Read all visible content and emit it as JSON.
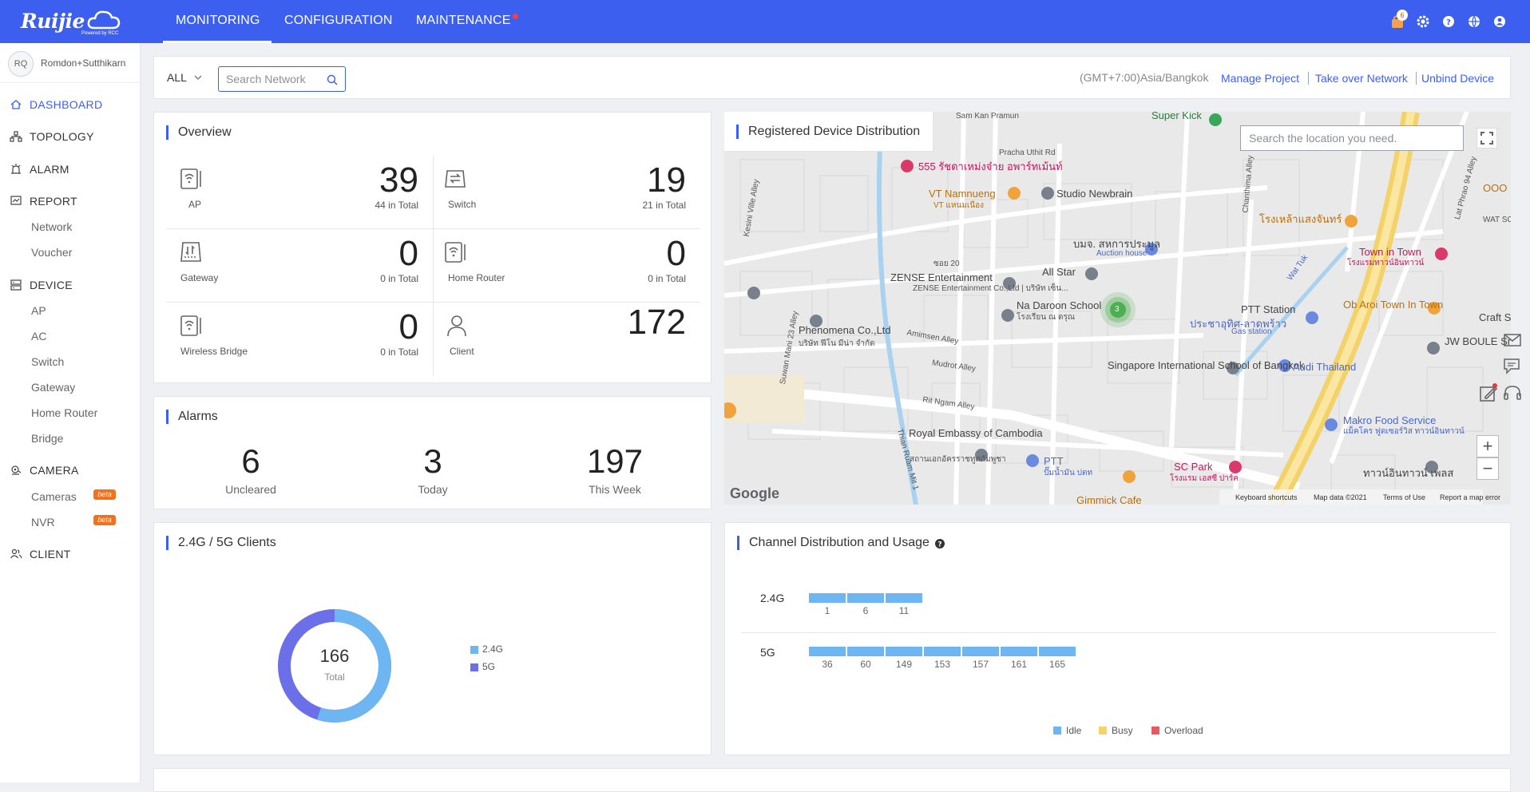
{
  "brand": {
    "name": "Ruijie",
    "sub": "Powered by RCC"
  },
  "nav": {
    "items": [
      {
        "label": "MONITORING"
      },
      {
        "label": "CONFIGURATION"
      },
      {
        "label": "MAINTENANCE"
      }
    ],
    "notification_count": "6"
  },
  "sidebar": {
    "user": {
      "initials": "RQ",
      "name": "Romdon+Sutthikarn"
    },
    "items": [
      {
        "label": "DASHBOARD"
      },
      {
        "label": "TOPOLOGY"
      },
      {
        "label": "ALARM"
      },
      {
        "label": "REPORT"
      },
      {
        "label": "DEVICE"
      },
      {
        "label": "CAMERA"
      },
      {
        "label": "CLIENT"
      }
    ],
    "report_sub": [
      "Network",
      "Voucher"
    ],
    "device_sub": [
      "AP",
      "AC",
      "Switch",
      "Gateway",
      "Home Router",
      "Bridge"
    ],
    "camera_sub": [
      "Cameras",
      "NVR"
    ],
    "beta_label": "beta"
  },
  "filter": {
    "scope": "ALL",
    "search_placeholder": "Search Network",
    "timezone": "(GMT+7:00)Asia/Bangkok",
    "links": [
      "Manage Project",
      "Take over Network",
      "Unbind Device"
    ]
  },
  "overview": {
    "title": "Overview",
    "cells": [
      {
        "name": "AP",
        "count": "39",
        "total": "44 in Total"
      },
      {
        "name": "Switch",
        "count": "19",
        "total": "21 in Total"
      },
      {
        "name": "Gateway",
        "count": "0",
        "total": "0 in Total"
      },
      {
        "name": "Home Router",
        "count": "0",
        "total": "0 in Total"
      },
      {
        "name": "Wireless Bridge",
        "count": "0",
        "total": "0 in Total"
      },
      {
        "name": "Client",
        "count": "172",
        "total": ""
      }
    ]
  },
  "alarms": {
    "title": "Alarms",
    "items": [
      {
        "value": "6",
        "label": "Uncleared"
      },
      {
        "value": "3",
        "label": "Today"
      },
      {
        "value": "197",
        "label": "This Week"
      }
    ]
  },
  "map": {
    "title": "Registered Device Distribution",
    "search_placeholder": "Search the location you need.",
    "cluster_count": "3",
    "labels": [
      "Super Kick",
      "Pracha Uthit Rd",
      "555 รัชดาเหม่งจ๋าย อพาร์ทเม้นท์",
      "VT Namnueng",
      "VT แหนมเนือง",
      "Studio Newbrain",
      "บมจ. สหการประมูล",
      "Auction house",
      "All Star",
      "ZENSE Entertainment",
      "ZENSE Entertainment Co.,Ltd | บริษัท เซ็น...",
      "Na Daroon School",
      "โรงเรียน ณ ดรุณ",
      "Phenomena Co.,Ltd",
      "บริษัท ฟีโน มีน่า จำกัด",
      "Singapore International School of Bangkok",
      "PTT Station",
      "ประชาอุทิศ-ลาดพร้าว",
      "Gas station",
      "Audi Thailand",
      "Ob Aroi Town In Town",
      "JW BOULE Srivara",
      "Royal Embassy of Cambodia",
      "สถานเอกอัครราชทูตกัมพูชา",
      "PTT",
      "ปั๊มน้ำมัน ปตท",
      "Makro Food Service",
      "แม็คโคร ฟูดเซอร์วิส ทาวน์อินทาวน์",
      "SC Park",
      "โรงแรม เอสซี ปาร์ค",
      "Gimmick Cafe",
      "Town in Town",
      "โรงแรมทาวน์อินทาวน์",
      "โรงเหล้าแสงจันทร์",
      "Craft St",
      "Amimsen Alley",
      "Mudrot Alley",
      "Rit Ngam Alley",
      "Kesini Ville Alley",
      "Suwan Mani 23 Alley",
      "Chanthima Alley",
      "Lat Phrao 94 Alley",
      "Thian Ruam Mit 1",
      "Sam Kan Pramun",
      "ซอย 20",
      "ทาวน์อินทาวน์ เพลส",
      "Wat Tuk",
      "WAT SCEN วัดเส",
      "OOO"
    ],
    "footer": [
      "Keyboard shortcuts",
      "Map data ©2021",
      "Terms of Use",
      "Report a map error"
    ],
    "google": "Google"
  },
  "clients": {
    "title": "2.4G / 5G Clients",
    "total": "166",
    "total_label": "Total",
    "legend": [
      {
        "name": "2.4G",
        "color": "#6db6f2"
      },
      {
        "name": "5G",
        "color": "#6b6fe8"
      }
    ],
    "fraction_24g": 0.55
  },
  "channels": {
    "title": "Channel Distribution and Usage",
    "bands": [
      {
        "name": "2.4G",
        "channels": [
          "1",
          "6",
          "11"
        ]
      },
      {
        "name": "5G",
        "channels": [
          "36",
          "60",
          "149",
          "153",
          "157",
          "161",
          "165"
        ]
      }
    ],
    "legend": [
      {
        "name": "Idle",
        "color": "#6db6f2"
      },
      {
        "name": "Busy",
        "color": "#f5d36b"
      },
      {
        "name": "Overload",
        "color": "#e8595f"
      }
    ]
  }
}
